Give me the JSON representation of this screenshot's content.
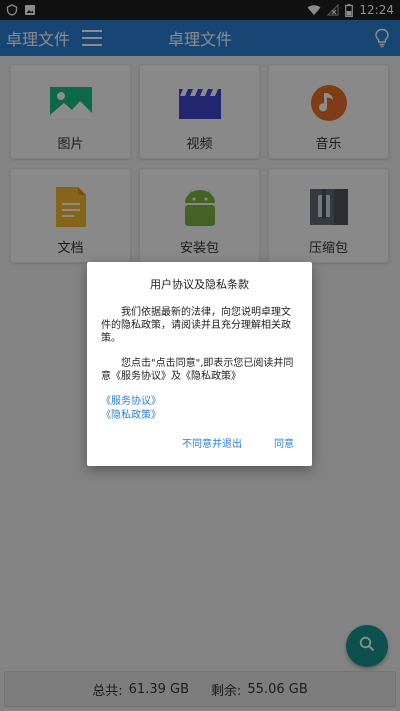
{
  "status_bar": {
    "time": "12:24"
  },
  "app_bar": {
    "app_name": "卓理文件",
    "page_title": "卓理文件"
  },
  "categories": [
    {
      "label": "图片",
      "icon": "image-icon"
    },
    {
      "label": "视频",
      "icon": "video-icon"
    },
    {
      "label": "音乐",
      "icon": "music-icon"
    },
    {
      "label": "文档",
      "icon": "document-icon"
    },
    {
      "label": "安装包",
      "icon": "android-icon"
    },
    {
      "label": "压缩包",
      "icon": "archive-icon"
    }
  ],
  "storage": {
    "total_label": "总共:",
    "total_value": "61.39 GB",
    "free_label": "剩余:",
    "free_value": "55.06 GB"
  },
  "dialog": {
    "title": "用户协议及隐私条款",
    "paragraph1": "我们依据最新的法律，向您说明卓理文件的隐私政策，请阅读并且充分理解相关政策。",
    "paragraph2": "您点击\"点击同意\",即表示您已阅读并同意《服务协议》及《隐私政策》",
    "link_service": "《服务协议》",
    "link_privacy": "《隐私政策》",
    "decline_label": "不同意并退出",
    "agree_label": "同意"
  },
  "colors": {
    "primary": "#2c80d3",
    "fab": "#17948d",
    "status_bar": "#1f1f1f"
  }
}
